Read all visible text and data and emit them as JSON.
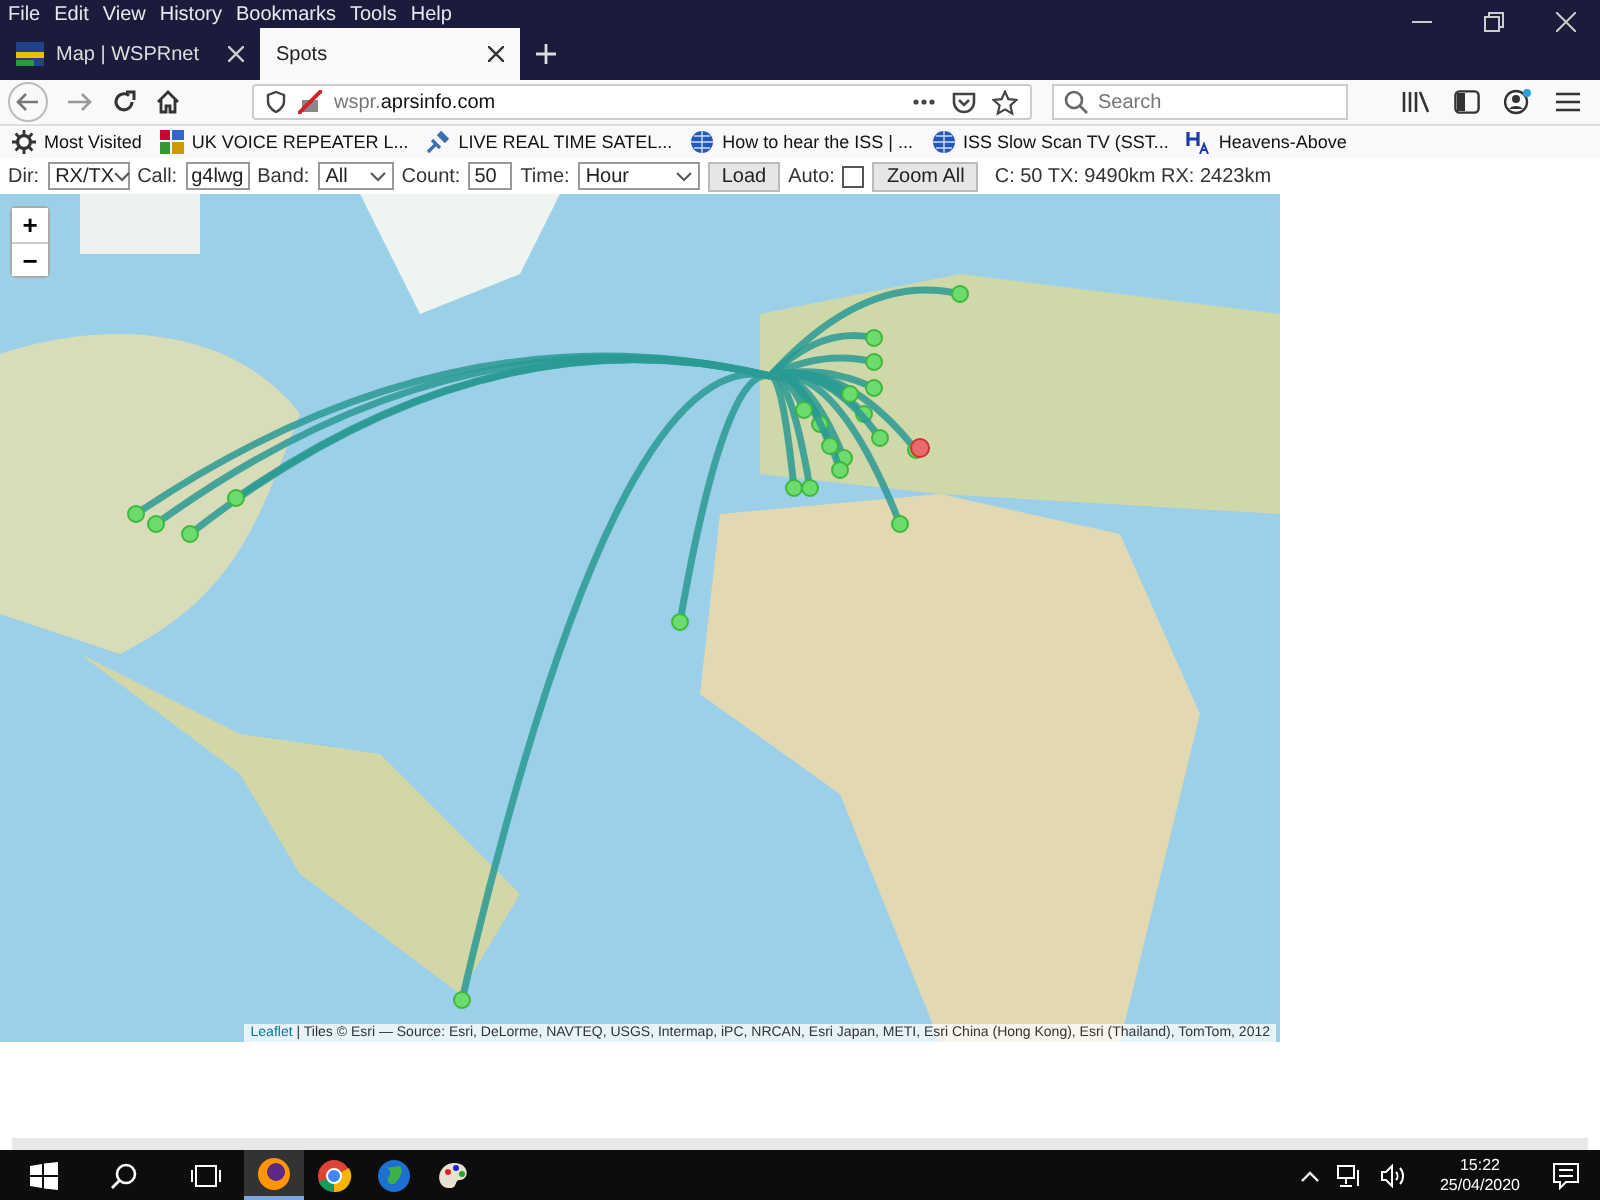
{
  "menu": [
    "File",
    "Edit",
    "View",
    "History",
    "Bookmarks",
    "Tools",
    "Help"
  ],
  "tabs": [
    {
      "label": "Map | WSPRnet",
      "selected": false
    },
    {
      "label": "Spots",
      "selected": true
    }
  ],
  "address": {
    "host": "wspr.",
    "domain": "aprsinfo.com"
  },
  "search": {
    "placeholder": "Search"
  },
  "bookmarks": [
    {
      "label": "Most Visited",
      "kind": "gear"
    },
    {
      "label": "UK VOICE REPEATER L...",
      "kind": "tag"
    },
    {
      "label": "LIVE REAL TIME SATEL...",
      "kind": "sat"
    },
    {
      "label": "How to hear the ISS | ...",
      "kind": "globe"
    },
    {
      "label": "ISS Slow Scan TV (SST...",
      "kind": "globe"
    },
    {
      "label": "Heavens-Above",
      "kind": "ha"
    }
  ],
  "controls": {
    "dir_label": "Dir:",
    "dir": "RX/TX",
    "call_label": "Call:",
    "call": "g4lwg",
    "band_label": "Band:",
    "band": "All",
    "count_label": "Count:",
    "count": "50",
    "time_label": "Time:",
    "time": "Hour",
    "load": "Load",
    "auto_label": "Auto:",
    "auto": false,
    "zoom_all": "Zoom All",
    "summary": "C: 50 TX: 9490km RX: 2423km"
  },
  "map": {
    "zoom_in": "+",
    "zoom_out": "−",
    "attribution_link": "Leaflet",
    "attribution": "| Tiles © Esri — Source: Esri, DeLorme, NAVTEQ, USGS, Intermap, iPC, NRCAN, Esri Japan, METI, Esri China (Hong Kong), Esri (Thailand), TomTom, 2012"
  },
  "taskbar": {
    "apps": [
      {
        "kind": "firefox",
        "selected": true
      },
      {
        "kind": "chrome",
        "selected": false
      },
      {
        "kind": "globe",
        "selected": false
      },
      {
        "kind": "paint",
        "selected": false
      }
    ],
    "time": "15:22",
    "date": "25/04/2020"
  }
}
